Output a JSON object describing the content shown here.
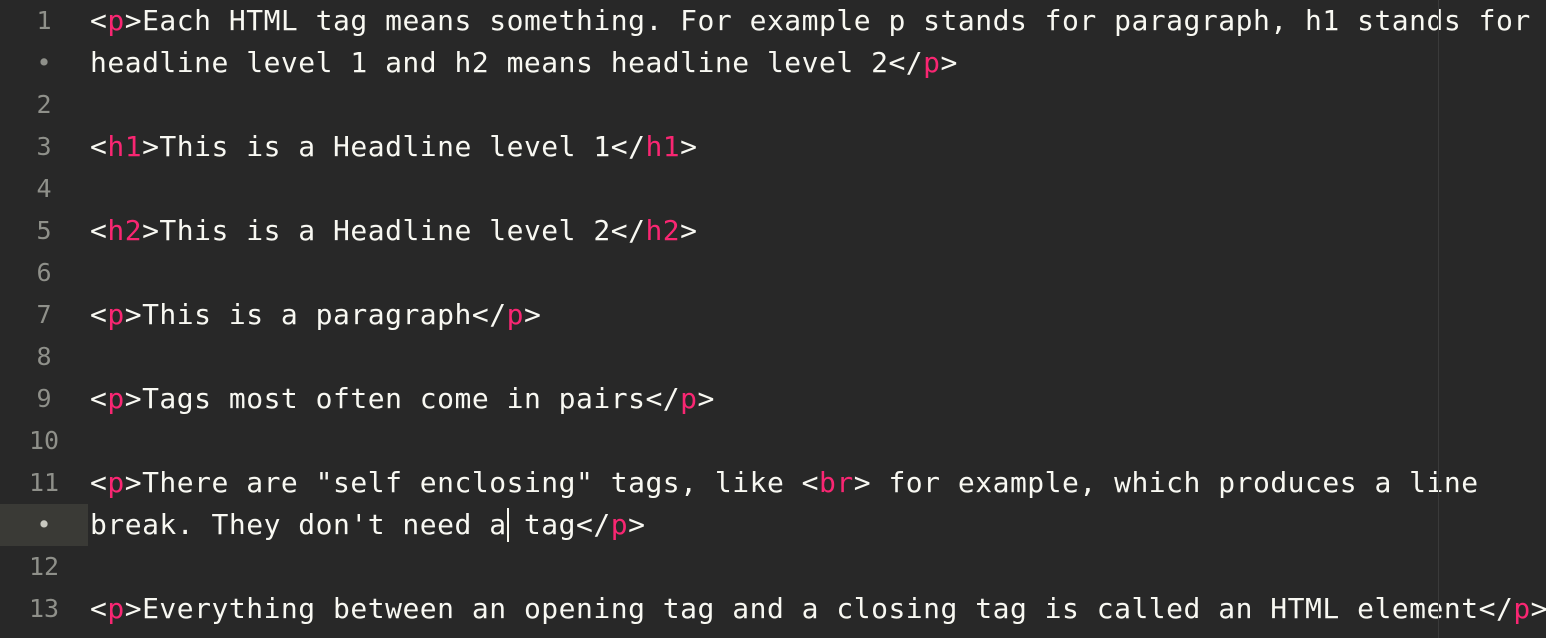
{
  "gutter": {
    "rows": [
      "1",
      "•",
      "2",
      "3",
      "4",
      "5",
      "6",
      "7",
      "8",
      "9",
      "10",
      "11",
      "•",
      "12",
      "13"
    ],
    "active_index": 12
  },
  "lines": [
    [
      {
        "t": "<",
        "k": "p"
      },
      {
        "t": "p",
        "k": "tag"
      },
      {
        "t": ">Each HTML tag means something. For example p stands for paragraph, h1 stands for",
        "k": "p"
      }
    ],
    [
      {
        "t": "headline level 1 and h2 means headline level 2</",
        "k": "p"
      },
      {
        "t": "p",
        "k": "tag"
      },
      {
        "t": ">",
        "k": "p"
      }
    ],
    [],
    [
      {
        "t": "<",
        "k": "p"
      },
      {
        "t": "h1",
        "k": "tag"
      },
      {
        "t": ">This is a Headline level 1</",
        "k": "p"
      },
      {
        "t": "h1",
        "k": "tag"
      },
      {
        "t": ">",
        "k": "p"
      }
    ],
    [],
    [
      {
        "t": "<",
        "k": "p"
      },
      {
        "t": "h2",
        "k": "tag"
      },
      {
        "t": ">This is a Headline level 2</",
        "k": "p"
      },
      {
        "t": "h2",
        "k": "tag"
      },
      {
        "t": ">",
        "k": "p"
      }
    ],
    [],
    [
      {
        "t": "<",
        "k": "p"
      },
      {
        "t": "p",
        "k": "tag"
      },
      {
        "t": ">This is a paragraph</",
        "k": "p"
      },
      {
        "t": "p",
        "k": "tag"
      },
      {
        "t": ">",
        "k": "p"
      }
    ],
    [],
    [
      {
        "t": "<",
        "k": "p"
      },
      {
        "t": "p",
        "k": "tag"
      },
      {
        "t": ">Tags most often come in pairs</",
        "k": "p"
      },
      {
        "t": "p",
        "k": "tag"
      },
      {
        "t": ">",
        "k": "p"
      }
    ],
    [],
    [
      {
        "t": "<",
        "k": "p"
      },
      {
        "t": "p",
        "k": "tag"
      },
      {
        "t": ">There are \"self enclosing\" tags, like <",
        "k": "p"
      },
      {
        "t": "br",
        "k": "tag"
      },
      {
        "t": "> for example, which produces a line",
        "k": "p"
      }
    ],
    [
      {
        "t": "break. They don't need a tag</",
        "k": "p"
      },
      {
        "t": "p",
        "k": "tag"
      },
      {
        "t": ">",
        "k": "p"
      }
    ],
    [],
    [
      {
        "t": "<",
        "k": "p"
      },
      {
        "t": "p",
        "k": "tag"
      },
      {
        "t": ">Everything between an opening tag and a closing tag is called an HTML element</",
        "k": "p"
      },
      {
        "t": "p",
        "k": "tag"
      },
      {
        "t": ">",
        "k": "p"
      }
    ]
  ],
  "cursor": {
    "line_index": 12,
    "column": 24
  },
  "colors": {
    "background": "#282828",
    "text": "#f8f8f2",
    "tag_name": "#f92672",
    "gutter_text": "#8f908a",
    "active_gutter_bg": "#3a3a36"
  }
}
